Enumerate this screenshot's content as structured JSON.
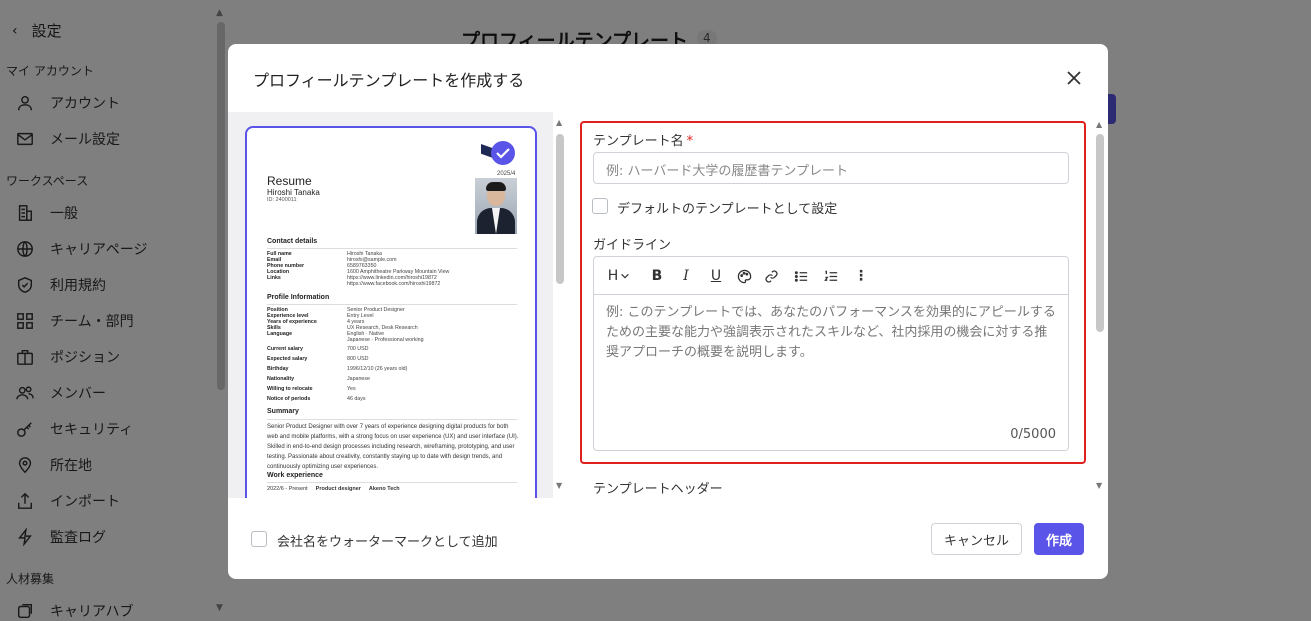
{
  "sidebar": {
    "back_label": "設定",
    "sections": [
      {
        "label": "マイ アカウント"
      },
      {
        "label": "ワークスペース"
      },
      {
        "label": "人材募集"
      }
    ],
    "items": [
      {
        "label": "アカウント",
        "icon": "user-icon"
      },
      {
        "label": "メール設定",
        "icon": "mail-icon"
      },
      {
        "label": "一般",
        "icon": "building-icon"
      },
      {
        "label": "キャリアページ",
        "icon": "globe-icon"
      },
      {
        "label": "利用規約",
        "icon": "shield-icon"
      },
      {
        "label": "チーム・部門",
        "icon": "grid-icon"
      },
      {
        "label": "ポジション",
        "icon": "briefcase-icon"
      },
      {
        "label": "メンバー",
        "icon": "users-icon"
      },
      {
        "label": "セキュリティ",
        "icon": "key-icon"
      },
      {
        "label": "所在地",
        "icon": "location-icon"
      },
      {
        "label": "インポート",
        "icon": "upload-icon"
      },
      {
        "label": "監査ログ",
        "icon": "bolt-icon"
      },
      {
        "label": "キャリアハブ",
        "icon": "hub-icon"
      }
    ]
  },
  "main": {
    "title": "プロフィールテンプレート",
    "count": "4"
  },
  "modal": {
    "title": "プロフィールテンプレートを作成する",
    "preview": {
      "date": "2025/4",
      "heading": "Resume",
      "name": "Hiroshi Tanaka",
      "id": "ID: 2400011",
      "contact_title": "Contact details",
      "contact": [
        {
          "k": "Full name",
          "v": "Hiroshi Tanaka"
        },
        {
          "k": "Email",
          "v": "hiroshi@sample.com"
        },
        {
          "k": "Phone number",
          "v": "6589763350"
        },
        {
          "k": "Location",
          "v": "1600 Amphitheatre Parkway Mountain View"
        },
        {
          "k": "Links",
          "v": "https://www.linkedin.com/hiroshi19872"
        },
        {
          "k": "",
          "v": "https://www.facebook.com/hiroshi19872"
        }
      ],
      "profile_title": "Profile Information",
      "profile": [
        {
          "k": "Position",
          "v": "Senior Product Designer"
        },
        {
          "k": "Experience level",
          "v": "Entry Level"
        },
        {
          "k": "Years of experience",
          "v": "4 years"
        },
        {
          "k": "Skills",
          "v": "UX Research, Desk Research"
        },
        {
          "k": "Language",
          "v": "English · Native"
        },
        {
          "k": "",
          "v": "Japanese · Professional working"
        },
        {
          "k": "Current salary",
          "v": "700 USD"
        },
        {
          "k": "Expected salary",
          "v": "800 USD"
        },
        {
          "k": "Birthday",
          "v": "1996/12/10 (26 years old)"
        },
        {
          "k": "Nationality",
          "v": "Japanese"
        },
        {
          "k": "Willing to relocate",
          "v": "Yes"
        },
        {
          "k": "Notice of periods",
          "v": "46 days"
        }
      ],
      "summary_title": "Summary",
      "summary": "Senior Product Designer with over 7 years of experience designing digital products for both web and mobile platforms, with a strong focus on user experience (UX) and user interface (UI). Skilled in end-to-end design processes including research, wireframing, prototyping, and user testing. Passionate about creativity, constantly staying up to date with design trends, and continuously optimizing user experiences.",
      "work_title": "Work experience",
      "work_period": "2022/6 - Present",
      "work_role": "Product designer",
      "work_company": "Akeno Tech"
    },
    "form": {
      "template_name_label": "テンプレート名",
      "required_mark": "*",
      "template_name_placeholder": "例: ハーバード大学の履歴書テンプレート",
      "default_checkbox_label": "デフォルトのテンプレートとして設定",
      "guideline_label": "ガイドライン",
      "toolbar": {
        "heading": "H",
        "bold": "B",
        "italic": "I",
        "underline": "U",
        "more": "⋮"
      },
      "guideline_placeholder": "例: このテンプレートでは、あなたのパフォーマンスを効果的にアピールするための主要な能力や強調表示されたスキルなど、社内採用の機会に対する推奨アプローチの概要を説明します。",
      "char_count": "0/5000",
      "template_header_label": "テンプレートヘッダー"
    },
    "footer": {
      "watermark_label": "会社名をウォーターマークとして追加",
      "cancel_label": "キャンセル",
      "create_label": "作成"
    }
  },
  "colors": {
    "accent": "#5b54e8",
    "highlight_border": "#e0201c",
    "overlay": "rgba(0,0,0,0.5)"
  }
}
